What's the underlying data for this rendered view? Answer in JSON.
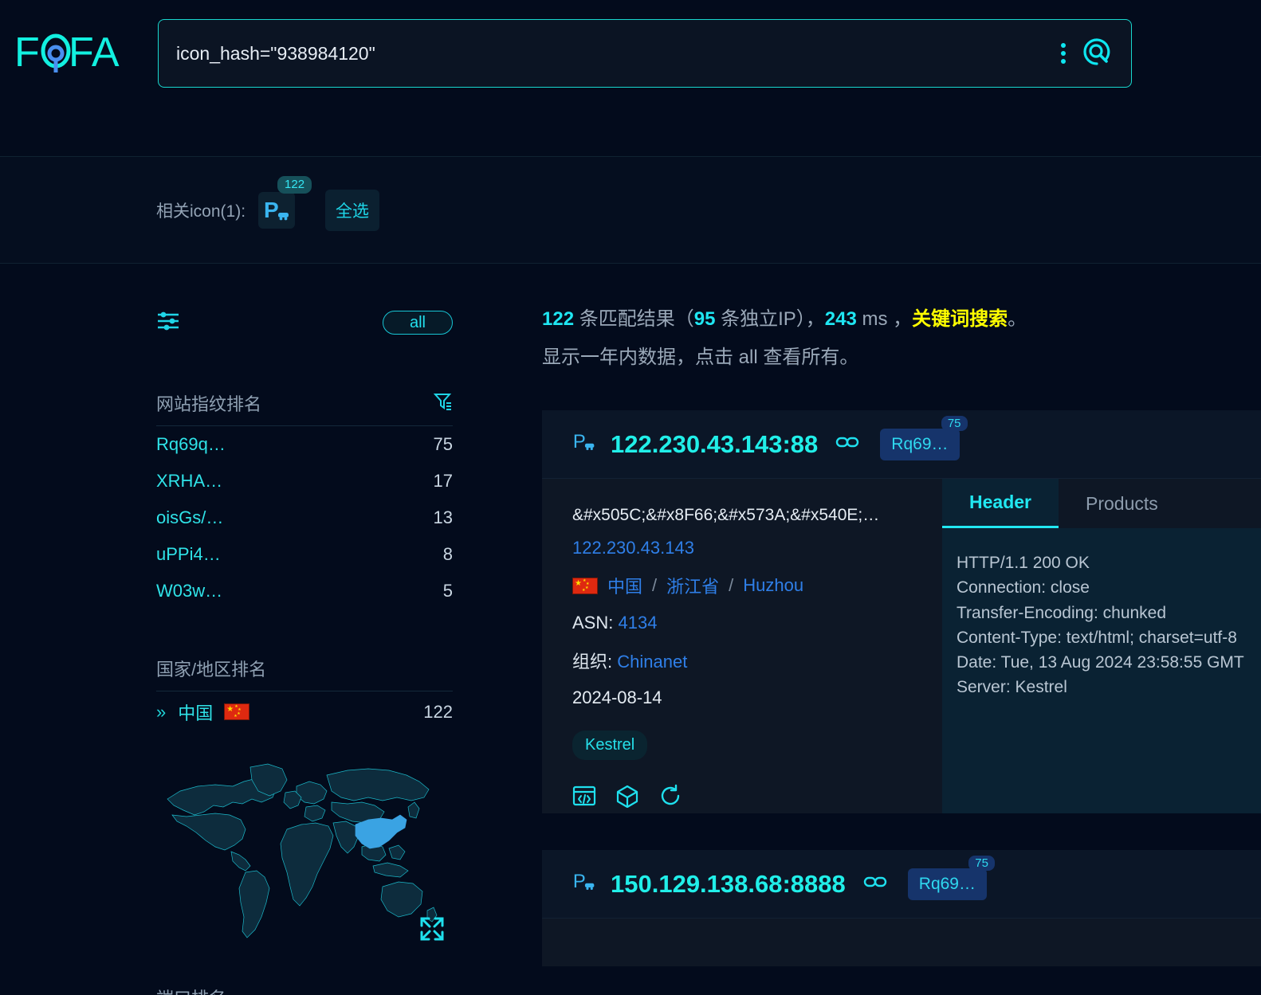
{
  "app": {
    "name": "FOFA"
  },
  "search": {
    "query": "icon_hash=\"938984120\"",
    "placeholder": "",
    "kebab_name": "more-options",
    "submit_name": "search"
  },
  "icon_band": {
    "label": "相关icon(1):",
    "icon_badge_count": "122",
    "select_all_label": "全选"
  },
  "sidebar": {
    "all_pill": "all",
    "fingerprint": {
      "title": "网站指纹排名",
      "rows": [
        {
          "name": "Rq69q…",
          "value": "75"
        },
        {
          "name": "XRHA…",
          "value": "17"
        },
        {
          "name": "oisGs/…",
          "value": "13"
        },
        {
          "name": "uPPi4…",
          "value": "8"
        },
        {
          "name": "W03w…",
          "value": "5"
        }
      ]
    },
    "country": {
      "title": "国家/地区排名",
      "rows": [
        {
          "chevron": "»",
          "name": "中国",
          "flag": "cn",
          "value": "122"
        }
      ]
    },
    "map": {
      "highlight_country": "中国",
      "highlight_color": "#3aa3e3"
    },
    "bottom_partial": "端口排名"
  },
  "results": {
    "summary": {
      "total": "122",
      "total_suffix": " 条匹配结果（",
      "unique": "95",
      "unique_suffix": " 条独立IP），",
      "duration": "243",
      "duration_unit": " ms ，",
      "search_type": "关键词搜索",
      "period": "。"
    },
    "sub_prefix": "显示一年内数据，点击 ",
    "sub_link": "all",
    "sub_suffix": " 查看所有。",
    "cards": [
      {
        "host": "122.230.43.143:88",
        "fingerprint_chip": "Rq69…",
        "fingerprint_badge": "75",
        "title": "&#x505C;&#x8F66;&#x573A;&#x540E;…",
        "ip": "122.230.43.143",
        "country": "中国",
        "region": "浙江省",
        "city": "Huzhou",
        "asn_label": "ASN:",
        "asn": "4134",
        "org_label": "组织:",
        "org": "Chinanet",
        "date": "2024-08-14",
        "tag": "Kestrel",
        "tabs": [
          {
            "label": "Header",
            "active": true
          },
          {
            "label": "Products",
            "active": false
          }
        ],
        "header_text": "HTTP/1.1 200 OK\nConnection: close\nTransfer-Encoding: chunked\nContent-Type: text/html; charset=utf-8\nDate: Tue, 13 Aug 2024 23:58:55 GMT\nServer: Kestrel"
      },
      {
        "host": "150.129.138.68:8888",
        "fingerprint_chip": "Rq69…",
        "fingerprint_badge": "75"
      }
    ]
  },
  "colors": {
    "accent": "#21efe9",
    "link": "#2f7fe8",
    "highlight": "#ffff00",
    "page_bg": "#030b1c",
    "card_bg": "#0e1725",
    "panel_bg": "#0a2233"
  }
}
